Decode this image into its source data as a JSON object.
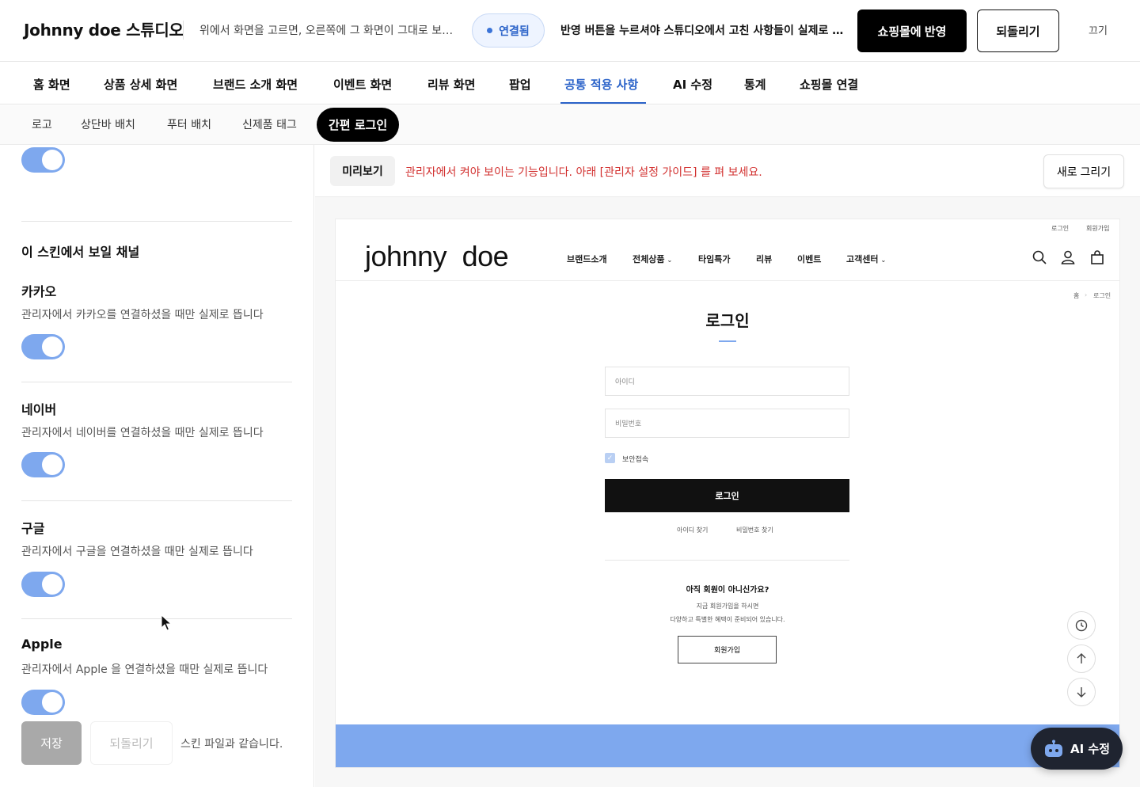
{
  "header": {
    "title": "Johnny doe 스튜디오",
    "hint": "위에서 화면을 고르면, 오른쪽에 그 화면이 그대로 보입니다",
    "status": "연결됨",
    "notice": "반영 버튼을 누르셔야 스튜디오에서 고친 사항들이 실제로 반영됩니다",
    "apply_label": "쇼핑몰에 반영",
    "revert_label": "되돌리기",
    "off_label": "끄기"
  },
  "main_tabs": [
    "홈 화면",
    "상품 상세 화면",
    "브랜드 소개 화면",
    "이벤트 화면",
    "리뷰 화면",
    "팝업",
    "공통 적용 사항",
    "AI 수정",
    "통계",
    "쇼핑몰 연결"
  ],
  "active_main_tab": "공통 적용 사항",
  "sub_tabs": [
    "로고",
    "상단바 배치",
    "푸터 배치",
    "신제품 태그",
    "간편 로그인"
  ],
  "active_sub_tab": "간편 로그인",
  "left": {
    "section_title": "이 스킨에서 보일 채널",
    "channels": [
      {
        "name": "카카오",
        "desc": "관리자에서 카카오를 연결하셨을 때만 실제로 뜹니다",
        "enabled": true
      },
      {
        "name": "네이버",
        "desc": "관리자에서 네이버를 연결하셨을 때만 실제로 뜹니다",
        "enabled": true
      },
      {
        "name": "구글",
        "desc": "관리자에서 구글을 연결하셨을 때만 실제로 뜹니다",
        "enabled": true
      },
      {
        "name": "Apple",
        "desc": "관리자에서 Apple 을 연결하셨을 때만 실제로 뜹니다",
        "enabled": true
      }
    ],
    "save_label": "저장",
    "undo_label": "되돌리기",
    "same_note": "스킨 파일과 같습니다."
  },
  "preview": {
    "label": "미리보기",
    "warning": "관리자에서 켜야 보이는 기능입니다. 아래 [관리자 설정 가이드] 를 펴 보세요.",
    "redraw_label": "새로 그리기"
  },
  "site": {
    "util_links": [
      "로그인",
      "회원가입"
    ],
    "logo": "johnny doe",
    "nav": [
      {
        "label": "브랜드소개",
        "dropdown": false
      },
      {
        "label": "전체상품",
        "dropdown": true
      },
      {
        "label": "타임특가",
        "dropdown": false
      },
      {
        "label": "리뷰",
        "dropdown": false
      },
      {
        "label": "이벤트",
        "dropdown": false
      },
      {
        "label": "고객센터",
        "dropdown": true
      }
    ],
    "icons": [
      "search-icon",
      "user-icon",
      "shopping-bag-icon"
    ],
    "breadcrumb": [
      "홈",
      "로그인"
    ],
    "login_title": "로그인",
    "id_placeholder": "아이디",
    "pw_placeholder": "비밀번호",
    "secure_label": "보안접속",
    "login_button": "로그인",
    "find_id": "아이디 찾기",
    "find_pw": "비밀번호 찾기",
    "join_question": "아직 회원이 아니신가요?",
    "join_desc1": "지금 회원가입을 하시면",
    "join_desc2": "다양하고 특별한 혜택이 준비되어 있습니다.",
    "join_button": "회원가입",
    "accent_color": "#7ea8ee"
  },
  "ai_button_label": "AI 수정",
  "colors": {
    "primary": "#2b63c9",
    "toggle_on": "#7ea8ee",
    "warning": "#d2302f"
  }
}
